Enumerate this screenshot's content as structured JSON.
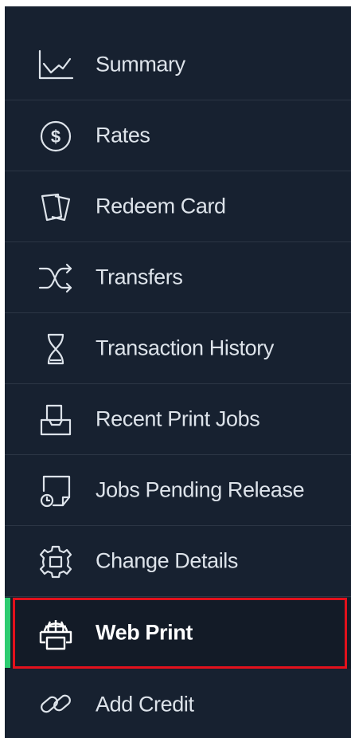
{
  "menu": {
    "items": [
      {
        "label": "Summary",
        "icon": "line-chart-icon",
        "active": false
      },
      {
        "label": "Rates",
        "icon": "dollar-circle-icon",
        "active": false
      },
      {
        "label": "Redeem Card",
        "icon": "cards-icon",
        "active": false
      },
      {
        "label": "Transfers",
        "icon": "shuffle-icon",
        "active": false
      },
      {
        "label": "Transaction History",
        "icon": "hourglass-icon",
        "active": false
      },
      {
        "label": "Recent Print Jobs",
        "icon": "printer-tray-icon",
        "active": false
      },
      {
        "label": "Jobs Pending Release",
        "icon": "document-clock-icon",
        "active": false
      },
      {
        "label": "Change Details",
        "icon": "gear-icon",
        "active": false
      },
      {
        "label": "Web Print",
        "icon": "web-printer-icon",
        "active": true
      },
      {
        "label": "Add Credit",
        "icon": "link-icon",
        "active": false
      }
    ]
  },
  "colors": {
    "sidebar_bg": "#172130",
    "active_bg": "#131b27",
    "active_accent": "#2ecc71",
    "highlight_border": "#e3111c",
    "text": "#dde3ea"
  }
}
